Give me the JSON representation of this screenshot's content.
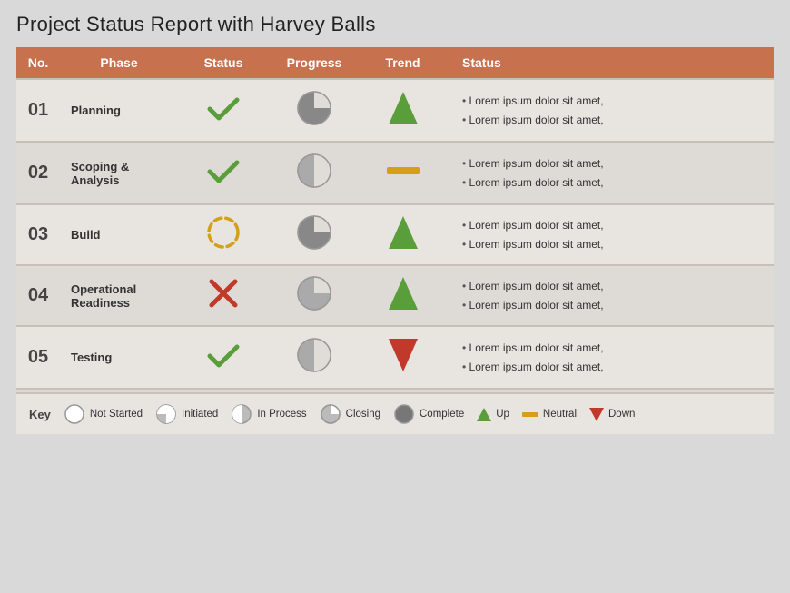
{
  "title": "Project Status Report with Harvey Balls",
  "header": {
    "no": "No.",
    "phase": "Phase",
    "status": "Status",
    "progress": "Progress",
    "trend": "Trend",
    "desc": "Status"
  },
  "rows": [
    {
      "no": "01",
      "phase": "Planning",
      "status": "check",
      "harvey": "closing",
      "trend": "up",
      "desc": [
        "Lorem ipsum dolor sit amet,",
        "Lorem ipsum dolor sit amet,"
      ]
    },
    {
      "no": "02",
      "phase": "Scoping & Analysis",
      "status": "check",
      "harvey": "half",
      "trend": "neutral",
      "desc": [
        "Lorem ipsum dolor sit amet,",
        "Lorem ipsum dolor sit amet,"
      ]
    },
    {
      "no": "03",
      "phase": "Build",
      "status": "inprogress",
      "harvey": "closing",
      "trend": "up",
      "desc": [
        "Lorem ipsum dolor sit amet,",
        "Lorem ipsum dolor sit amet,"
      ]
    },
    {
      "no": "04",
      "phase": "Operational Readiness",
      "status": "cross",
      "harvey": "quarter",
      "trend": "up",
      "desc": [
        "Lorem ipsum dolor sit amet,",
        "Lorem ipsum dolor sit amet,"
      ]
    },
    {
      "no": "05",
      "phase": "Testing",
      "status": "check",
      "harvey": "half",
      "trend": "down",
      "desc": [
        "Lorem ipsum dolor sit amet,",
        "Lorem ipsum dolor sit amet,"
      ]
    }
  ],
  "key": {
    "label": "Key",
    "items": [
      {
        "label": "Not Started",
        "type": "empty"
      },
      {
        "label": "Initiated",
        "type": "quarter-small"
      },
      {
        "label": "In Process",
        "type": "half-small"
      },
      {
        "label": "Closing",
        "type": "closing-small"
      },
      {
        "label": "Complete",
        "type": "full"
      },
      {
        "label": "Up",
        "type": "up"
      },
      {
        "label": "Neutral",
        "type": "neutral"
      },
      {
        "label": "Down",
        "type": "down"
      }
    ]
  }
}
